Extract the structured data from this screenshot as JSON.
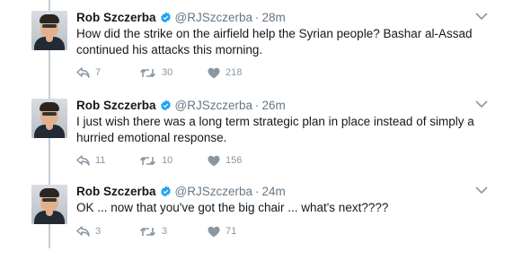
{
  "tweets": [
    {
      "name": "Rob Szczerba",
      "handle": "@RJSzczerba",
      "separator": "·",
      "time": "28m",
      "text": "How did the strike on the airfield help the Syrian people?  Bashar al-Assad continued his attacks this morning.",
      "replies": "7",
      "retweets": "30",
      "likes": "218"
    },
    {
      "name": "Rob Szczerba",
      "handle": "@RJSzczerba",
      "separator": "·",
      "time": "26m",
      "text": "I just wish there was a long term strategic plan in place instead of simply a hurried emotional response.",
      "replies": "11",
      "retweets": "10",
      "likes": "156"
    },
    {
      "name": "Rob Szczerba",
      "handle": "@RJSzczerba",
      "separator": "·",
      "time": "24m",
      "text": "OK ... now that you've got the big chair ... what's next????",
      "replies": "3",
      "retweets": "3",
      "likes": "71"
    }
  ],
  "colors": {
    "name": "#14171a",
    "meta": "#657786",
    "action": "#8a97a3",
    "verified": "#1da1f2",
    "thread_line": "#c4ccd3"
  },
  "icons": [
    "verified-badge-icon",
    "chevron-down-icon",
    "reply-icon",
    "retweet-icon",
    "heart-icon"
  ]
}
